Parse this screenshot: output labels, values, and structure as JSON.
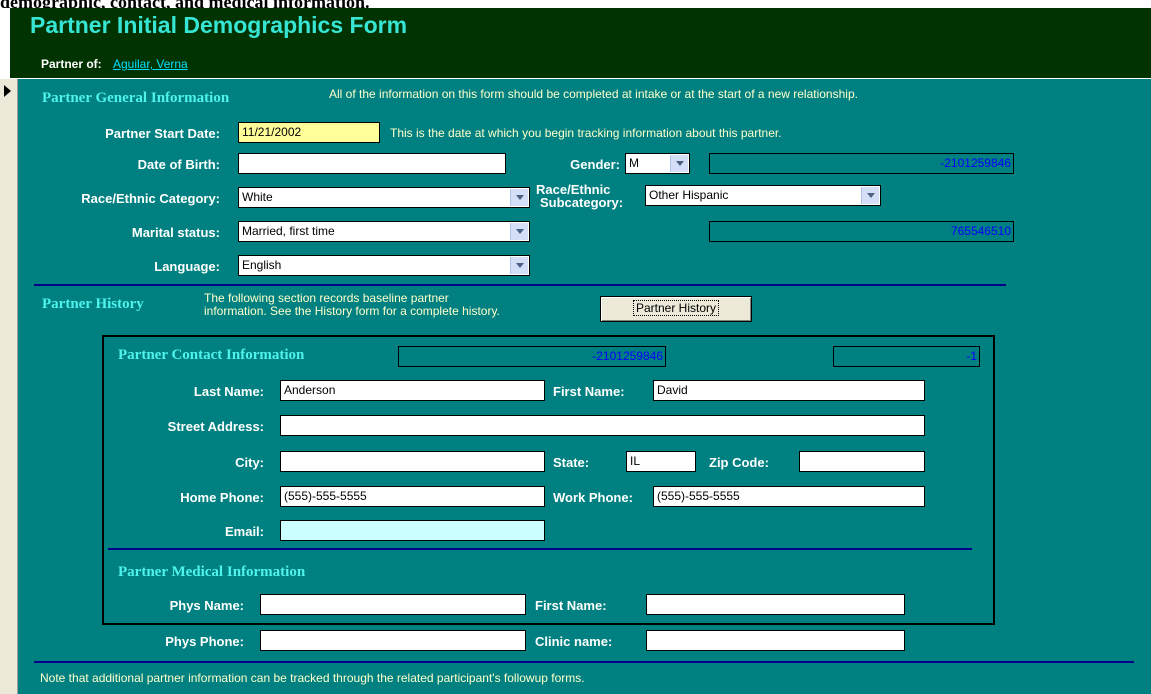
{
  "page": {
    "top_text": "demographic, contact, and medical information."
  },
  "header": {
    "title": "Partner Initial Demographics Form",
    "partner_of_label": "Partner of:",
    "partner_of_value": "Aguilar, Verna"
  },
  "general": {
    "heading": "Partner General Information",
    "heading_note": "All of the information on this form should be completed at intake or at the start of a new relationship.",
    "start_date_label": "Partner Start Date:",
    "start_date_value": "11/21/2002",
    "start_date_note": "This is the date at which you begin tracking information about this partner.",
    "dob_label": "Date of Birth:",
    "dob_value": "",
    "gender_label": "Gender:",
    "gender_value": "M",
    "gender_id": "-2101259846",
    "race_label": "Race/Ethnic Category:",
    "race_value": "White",
    "subcat_label_1": "Race/Ethnic",
    "subcat_label_2": "Subcategory:",
    "subcat_value": "Other Hispanic",
    "marital_label": "Marital status:",
    "marital_value": "Married, first time",
    "marital_id": "765546510",
    "language_label": "Language:",
    "language_value": "English"
  },
  "history": {
    "heading": "Partner History",
    "note_1": "The following section records baseline partner",
    "note_2": "information.  See the History form for a complete history.",
    "button_label": "Partner History"
  },
  "contact": {
    "heading": "Partner Contact Information",
    "id_1": "-2101259846",
    "id_2": "-1",
    "last_name_label": "Last Name:",
    "last_name_value": "Anderson",
    "first_name_label": "First Name:",
    "first_name_value": "David",
    "street_label": "Street Address:",
    "street_value": "",
    "city_label": "City:",
    "city_value": "",
    "state_label": "State:",
    "state_value": "IL",
    "zip_label": "Zip Code:",
    "zip_value": "",
    "home_phone_label": "Home Phone:",
    "home_phone_value": "(555)-555-5555",
    "work_phone_label": "Work Phone:",
    "work_phone_value": "(555)-555-5555",
    "email_label": "Email:",
    "email_value": ""
  },
  "medical": {
    "heading": "Partner Medical Information",
    "phys_name_label": "Phys Name:",
    "phys_name_value": "",
    "first_name_label": "First Name:",
    "first_name_value": "",
    "phys_phone_label": "Phys Phone:",
    "phys_phone_value": "",
    "clinic_label": "Clinic name:",
    "clinic_value": ""
  },
  "footer": {
    "note": "Note that additional partner information can be tracked through the related participant's followup forms."
  },
  "colors": {
    "form_background": "#008080",
    "header_background": "#003300",
    "heading_color": "#4ef3ee",
    "highlight_field": "#ffff99"
  },
  "icons": {
    "record_selector": "record-pointer-icon",
    "dropdown": "chevron-down-icon"
  }
}
